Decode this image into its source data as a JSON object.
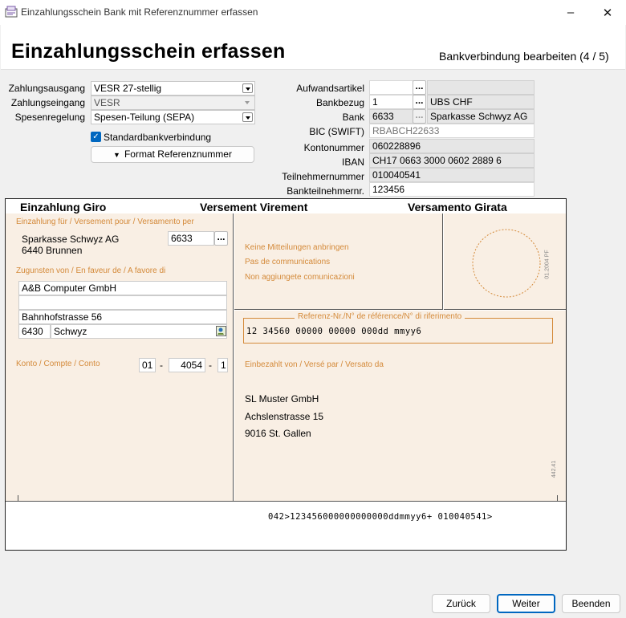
{
  "window": {
    "title": "Einzahlungsschein Bank mit Referenznummer erfassen",
    "minimize": "–",
    "close": "✕"
  },
  "header": {
    "title": "Einzahlungsschein erfassen",
    "step": "Bankverbindung bearbeiten (4 / 5)"
  },
  "left": {
    "zahlungsausgang": {
      "label": "Zahlungsausgang",
      "value": "VESR 27-stellig"
    },
    "zahlungseingang": {
      "label": "Zahlungseingang",
      "value": "VESR"
    },
    "spesenregelung": {
      "label": "Spesenregelung",
      "value": "Spesen-Teilung (SEPA)"
    },
    "standard_label": "Standardbankverbindung",
    "format_button": "Format Referenznummer"
  },
  "right": {
    "aufwandsartikel": {
      "label": "Aufwandsartikel",
      "value": "",
      "desc": ""
    },
    "bankbezug": {
      "label": "Bankbezug",
      "value": "1",
      "desc": "UBS CHF"
    },
    "bank": {
      "label": "Bank",
      "value": "6633",
      "desc": "Sparkasse Schwyz AG"
    },
    "bic": {
      "label": "BIC (SWIFT)",
      "value": "RBABCH22633"
    },
    "kontonummer": {
      "label": "Kontonummer",
      "value": "060228896"
    },
    "iban": {
      "label": "IBAN",
      "value": "CH17 0663 3000 0602 2889 6"
    },
    "teilnehmernummer": {
      "label": "Teilnehmernummer",
      "value": "010040541"
    },
    "bankteilnehmernr": {
      "label": "Bankteilnehmernr.",
      "value": "123456"
    }
  },
  "slip": {
    "title_de": "Einzahlung Giro",
    "title_fr": "Versement Virement",
    "title_it": "Versamento Girata",
    "einzahlung_fuer": "Einzahlung für / Versement pour / Versamento per",
    "bank_name": "Sparkasse Schwyz AG",
    "bank_city": "6440 Brunnen",
    "bank_code": "6633",
    "zugunsten": "Zugunsten von / En faveur de / A favore di",
    "addr1": "A&B Computer GmbH",
    "addr2": "",
    "addr3": "Bahnhofstrasse 56",
    "plz": "6430",
    "ort": "Schwyz",
    "konto_label": "Konto / Compte / Conto",
    "konto1": "01",
    "konto_sep1": "-",
    "konto2": "4054",
    "konto_sep2": "-",
    "konto3": "1",
    "mitteilung1": "Keine Mitteilungen anbringen",
    "mitteilung2": "Pas de communications",
    "mitteilung3": "Non aggiungete comunicazioni",
    "code_side": "01.2004 PF",
    "referenz_label": "Referenz-Nr./N° de référence/N° di riferimento",
    "referenz": "12 34560 00000 00000 000dd mmyy6",
    "einbezahlt": "Einbezahlt von / Versé par / Versato da",
    "payer1": "SL Muster GmbH",
    "payer2": "Achslenstrasse 15",
    "payer3": "9016 St. Gallen",
    "code_side2": "442.41",
    "codeline": "042>123456000000000000ddmmyy6+ 010040541>"
  },
  "footer": {
    "back": "Zurück",
    "next": "Weiter",
    "end": "Beenden"
  }
}
